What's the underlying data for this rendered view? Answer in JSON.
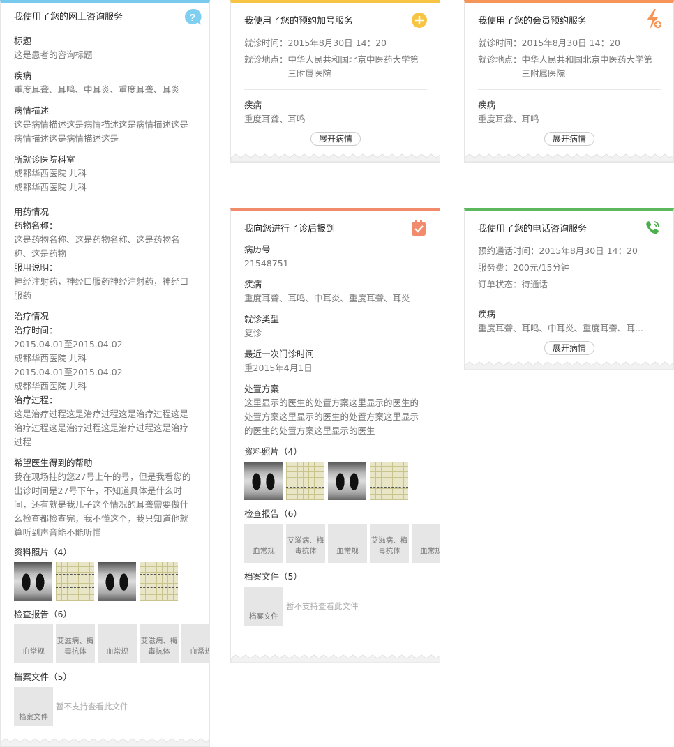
{
  "colors": {
    "blue": "#78c9ee",
    "yellow": "#f7c443",
    "orange": "#f59559",
    "salmon": "#f28b6b",
    "green": "#5cb85c"
  },
  "card1": {
    "title": "我使用了您的网上咨询服务",
    "icon": "question-bubble-icon",
    "subject_label": "标题",
    "subject_value": "这是患者的咨询标题",
    "disease_label": "疾病",
    "disease_value": "重度耳聋、耳鸣、中耳炎、重度耳聋、耳炎",
    "desc_label": "病情描述",
    "desc_value": "这是病情描述这是病情描述这是病情描述这是病情描述这是病情描述这是",
    "hospital_label": "所就诊医院科室",
    "hospital_value_1": "成都华西医院 儿科",
    "hospital_value_2": "成都华西医院 儿科",
    "med_label": "用药情况",
    "drug_name_label": "药物名称：",
    "drug_name_value": "这是药物名称、这是药物名称、这是药物名称、这是药物",
    "usage_label": "服用说明：",
    "usage_value": "神经注射药，神经口服药神经注射药，神经口服药",
    "treat_label": "治疗情况",
    "treat_time_label": "治疗时间：",
    "treat_date_1": "2015.04.01至2015.04.02",
    "treat_hosp_1": "成都华西医院 儿科",
    "treat_date_2": "2015.04.01至2015.04.02",
    "treat_hosp_2": "成都华西医院 儿科",
    "treat_process_label": "治疗过程：",
    "treat_process_value": "这是治疗过程这是治疗过程这是治疗过程这是治疗过程这是治疗过程这是治疗过程这是治疗过程",
    "help_label": "希望医生得到的帮助",
    "help_value": "我在现场挂的您27号上午的号，但是我看您的出诊时间是27号下午，不知道具体是什么时间，还有就是我儿子这个情况的耳聋需要做什么检查都检查完，我不懂这个，我只知道他就算听到声音能不能听懂",
    "photos_label": "资料照片（4）",
    "reports_label": "检查报告（6）",
    "reports": [
      "血常规",
      "艾滋病、梅毒抗体",
      "血常规",
      "艾滋病、梅毒抗体",
      "血常规"
    ],
    "files_label": "档案文件（5）",
    "file_name": "档案文件",
    "no_file_text": "暂不支持查看此文件"
  },
  "card2": {
    "title": "我使用了您的预约加号服务",
    "icon": "plus-circle-icon",
    "time_label": "就诊时间：",
    "time_value": "2015年8月30日 14：20",
    "place_label": "就诊地点：",
    "place_value": "中华人民共和国北京中医药大学第三附属医院",
    "disease_label": "疾病",
    "disease_value": "重度耳聋、耳鸣",
    "expand_label": "展开病情"
  },
  "card3": {
    "title": "我使用了您的会员预约服务",
    "icon": "lightning-plus-icon",
    "time_label": "就诊时间：",
    "time_value": "2015年8月30日 14：20",
    "place_label": "就诊地点：",
    "place_value": "中华人民共和国北京中医药大学第三附属医院",
    "disease_label": "疾病",
    "disease_value": "重度耳聋、耳鸣",
    "expand_label": "展开病情"
  },
  "card4": {
    "title": "我向您进行了诊后报到",
    "icon": "clipboard-check-icon",
    "record_label": "病历号",
    "record_value": "21548751",
    "disease_label": "疾病",
    "disease_value": "重度耳聋、耳鸣、中耳炎、重度耳聋、耳炎",
    "visit_type_label": "就诊类型",
    "visit_type_value": "复诊",
    "last_visit_label": "最近一次门诊时间",
    "last_visit_value": "重2015年4月1日",
    "plan_label": "处置方案",
    "plan_value": "这里显示的医生的处置方案这里显示的医生的处置方案这里显示的医生的处置方案这里显示的医生的处置方案这里显示的医生",
    "photos_label": "资料照片（4）",
    "reports_label": "检查报告（6）",
    "reports": [
      "血常规",
      "艾滋病、梅毒抗体",
      "血常规",
      "艾滋病、梅毒抗体",
      "血常规"
    ],
    "files_label": "档案文件（5）",
    "file_name": "档案文件",
    "no_file_text": "暂不支持查看此文件"
  },
  "card5": {
    "title": "我使用了您的电话咨询服务",
    "icon": "phone-icon",
    "call_time_label": "预约通话时间：",
    "call_time_value": "2015年8月30日 14：20",
    "fee_label": "服务费：",
    "fee_value": "200元/15分钟",
    "status_label": "订单状态：",
    "status_value": "待通话",
    "disease_label": "疾病",
    "disease_value": "重度耳聋、耳鸣、中耳炎、重度耳聋、耳...",
    "expand_label": "展开病情"
  }
}
